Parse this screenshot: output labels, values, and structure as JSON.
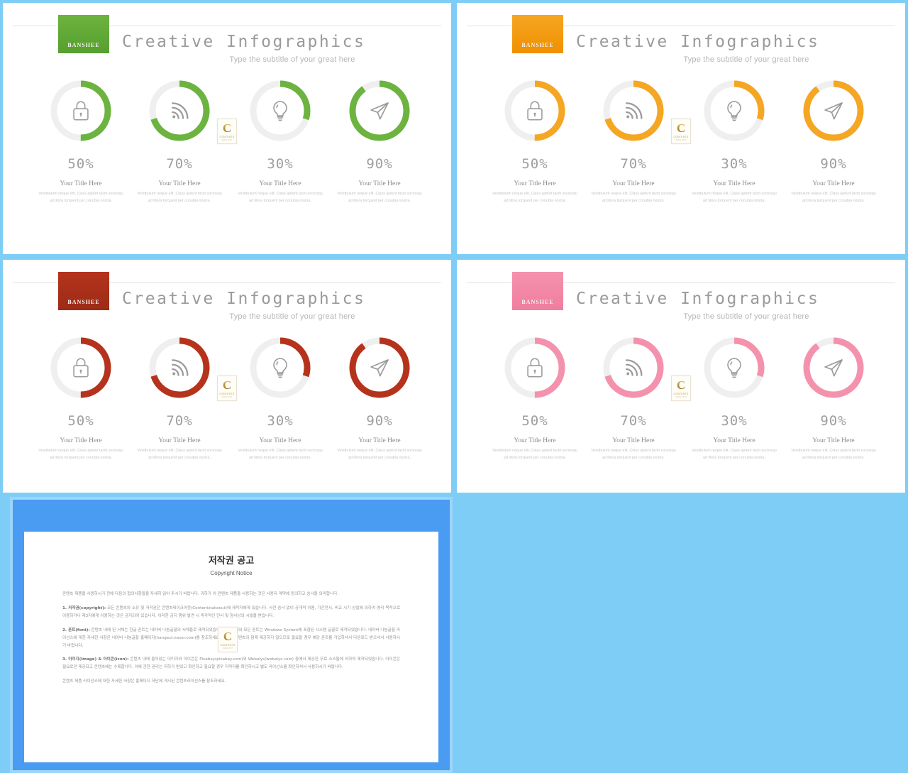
{
  "theme": {
    "page_background": "#7ecdf7",
    "slide_border": "#7ecdf7",
    "copyright_frame": "#4a9bf2"
  },
  "slides": [
    {
      "accent": "#6cb33f",
      "accent_dark": "#57a02d",
      "logo_label": "BANSHEE",
      "title": "Creative Infographics",
      "subtitle": "Type the subtitle of your great here",
      "items": [
        {
          "percent": 50,
          "percent_label": "50%",
          "icon": "lock-icon",
          "title": "Your Title Here",
          "desc": "Vestibulum neque elit, Class aptent taciti sociosqu ad litora torquent per conubia nostra."
        },
        {
          "percent": 70,
          "percent_label": "70%",
          "icon": "wifi-signal-icon",
          "title": "Your Title Here",
          "desc": "Vestibulum neque elit, Class aptent taciti sociosqu ad litora torquent per conubia nostra."
        },
        {
          "percent": 30,
          "percent_label": "30%",
          "icon": "lightbulb-icon",
          "title": "Your Title Here",
          "desc": "Vestibulum neque elit, Class aptent taciti sociosqu ad litora torquent per conubia nostra."
        },
        {
          "percent": 90,
          "percent_label": "90%",
          "icon": "paper-plane-icon",
          "title": "Your Title Here",
          "desc": "Vestibulum neque elit, Class aptent taciti sociosqu ad litora torquent per conubia nostra."
        }
      ]
    },
    {
      "accent": "#f5a623",
      "accent_dark": "#f09000",
      "logo_label": "BANSHEE",
      "title": "Creative Infographics",
      "subtitle": "Type the subtitle of your great here",
      "items": [
        {
          "percent": 50,
          "percent_label": "50%",
          "icon": "lock-icon",
          "title": "Your Title Here",
          "desc": "Vestibulum neque elit, Class aptent taciti sociosqu ad litora torquent per conubia nostra."
        },
        {
          "percent": 70,
          "percent_label": "70%",
          "icon": "wifi-signal-icon",
          "title": "Your Title Here",
          "desc": "Vestibulum neque elit, Class aptent taciti sociosqu ad litora torquent per conubia nostra."
        },
        {
          "percent": 30,
          "percent_label": "30%",
          "icon": "lightbulb-icon",
          "title": "Your Title Here",
          "desc": "Vestibulum neque elit, Class aptent taciti sociosqu ad litora torquent per conubia nostra."
        },
        {
          "percent": 90,
          "percent_label": "90%",
          "icon": "paper-plane-icon",
          "title": "Your Title Here",
          "desc": "Vestibulum neque elit, Class aptent taciti sociosqu ad litora torquent per conubia nostra."
        }
      ]
    },
    {
      "accent": "#b5331c",
      "accent_dark": "#9c2b16",
      "logo_label": "BANSHEE",
      "title": "Creative Infographics",
      "subtitle": "Type the subtitle of your great here",
      "items": [
        {
          "percent": 50,
          "percent_label": "50%",
          "icon": "lock-icon",
          "title": "Your Title Here",
          "desc": "Vestibulum neque elit, Class aptent taciti sociosqu ad litora torquent per conubia nostra."
        },
        {
          "percent": 70,
          "percent_label": "70%",
          "icon": "wifi-signal-icon",
          "title": "Your Title Here",
          "desc": "Vestibulum neque elit, Class aptent taciti sociosqu ad litora torquent per conubia nostra."
        },
        {
          "percent": 30,
          "percent_label": "30%",
          "icon": "lightbulb-icon",
          "title": "Your Title Here",
          "desc": "Vestibulum neque elit, Class aptent taciti sociosqu ad litora torquent per conubia nostra."
        },
        {
          "percent": 90,
          "percent_label": "90%",
          "icon": "paper-plane-icon",
          "title": "Your Title Here",
          "desc": "Vestibulum neque elit, Class aptent taciti sociosqu ad litora torquent per conubia nostra."
        }
      ]
    },
    {
      "accent": "#f492ad",
      "accent_dark": "#f07e9e",
      "logo_label": "BANSHEE",
      "title": "Creative Infographics",
      "subtitle": "Type the subtitle of your great here",
      "items": [
        {
          "percent": 50,
          "percent_label": "50%",
          "icon": "lock-icon",
          "title": "Your Title Here",
          "desc": "Vestibulum neque elit, Class aptent taciti sociosqu ad litora torquent per conubia nostra."
        },
        {
          "percent": 70,
          "percent_label": "70%",
          "icon": "wifi-signal-icon",
          "title": "Your Title Here",
          "desc": "Vestibulum neque elit, Class aptent taciti sociosqu ad litora torquent per conubia nostra."
        },
        {
          "percent": 30,
          "percent_label": "30%",
          "icon": "lightbulb-icon",
          "title": "Your Title Here",
          "desc": "Vestibulum neque elit, Class aptent taciti sociosqu ad litora torquent per conubia nostra."
        },
        {
          "percent": 90,
          "percent_label": "90%",
          "icon": "paper-plane-icon",
          "title": "Your Title Here",
          "desc": "Vestibulum neque elit, Class aptent taciti sociosqu ad litora torquent per conubia nostra."
        }
      ]
    }
  ],
  "watermark": {
    "letter": "C",
    "line1": "CONTENTS",
    "line2": "TAKE  OUT"
  },
  "copyright": {
    "title": "저작권 공고",
    "subtitle": "Copyright Notice",
    "intro": "콘텐츠 제품을 사용하시기 전에 다음의 협의사항들을 자세히 읽어 주시기 바랍니다. 귀하가 이 콘텐츠 제품을 사용하는 것은 사용자 계약에 동의하고 승낙을 의미합니다.",
    "p1_label": "1. 저작권(copyright):",
    "p1": "모든 콘텐츠의 소유 및 저작권은 콘텐츠테이크아웃(Contentstakeout)에 제작자에게 있습니다. 사전 승낙 없이 공개적 이용, 기간전시, 비교 시기 상업에 의하여 영리 목적으로 이용하거나 제3자에게 이용하는 것은 금지되어 있습니다. 이러한 금지 행위 발견 시 즉각적인 민사 및 형사상의 시빌을 받습니다.",
    "p2_label": "2. 폰트(font):",
    "p2": "콘텐츠 내에 된 서체는 한글 폰트는 네이버 나눔글꼴의 서체들로 제작되었습니다. 한글 외의 모든 폰트는 Windows System에 포함된 시스템 글꼴로 제작되었습니다. 네이버 나눔글꼴 라이선스에 대한 자세한 사항은 네이버 나눔글꼴 홈페이지(hangeul.naver.com)를 참조하세요. 폰트는 콘텐츠의 함께 제공하지 않으므로 필요할 경우 해당 폰트를 가입하셔서 다운로드 받으셔서 사용하시기 바랍니다.",
    "p3_label": "3. 이미지(image) & 아이콘(icon):",
    "p3": "콘텐츠 내에 들어있는 이미지와 아이콘은 Pixabay(pixabay.com)와 Webalys(webalys.com) 중에서 제공한 무료 소스들에 의하여 제작되었습니다. 아이콘은 필요로만 제공되고 콘텐츠에는 수록합니다. 이에 관한 권리는 귀하가 받았고 확인하고 필요할 경우 저작자를 확인하시고 별도 라이선스를 확인하셔서 사용하시기 바랍니다.",
    "footer": "콘텐츠 제품 라이선스에 대한 자세한 사항은 홈페이지 하단에 게시된 콘텐츠라이선스를 참조하세요."
  }
}
